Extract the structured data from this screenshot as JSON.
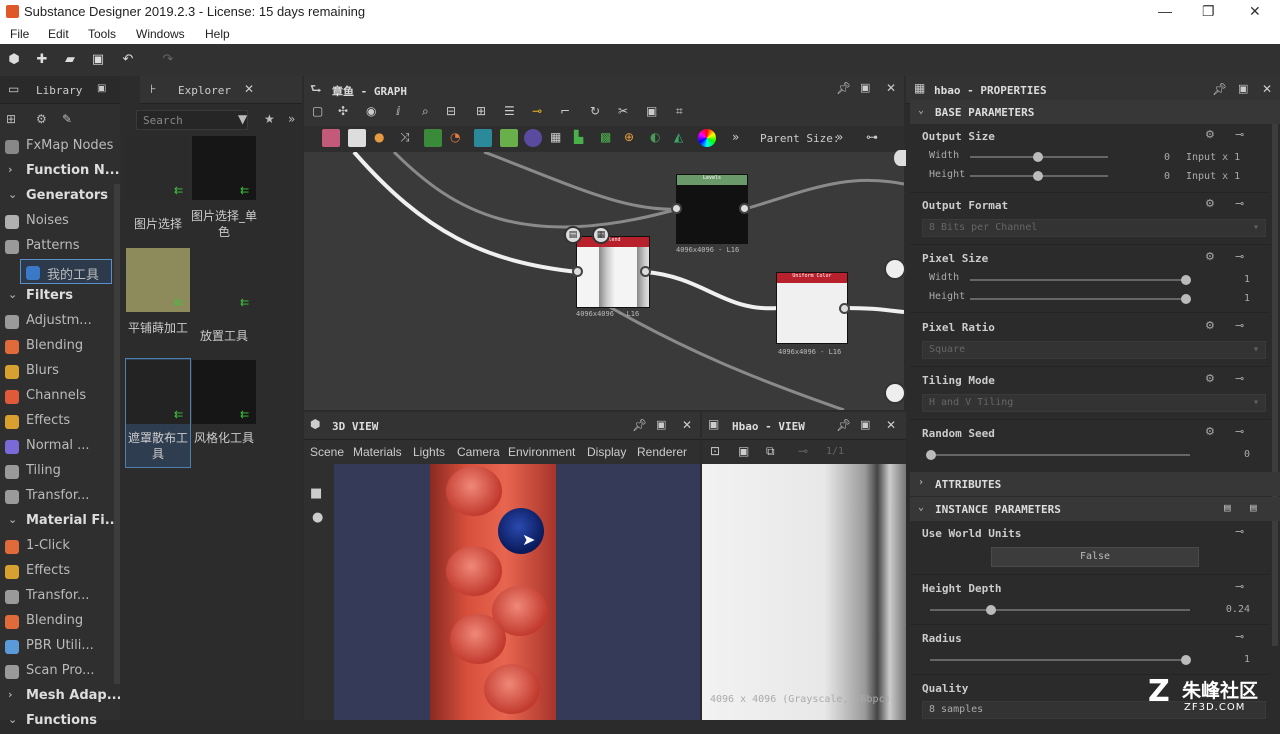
{
  "window": {
    "title": "Substance Designer 2019.2.3 - License: 15 days remaining",
    "minimize": "—",
    "restore": "❐",
    "close": "✕"
  },
  "menu": [
    "File",
    "Edit",
    "Tools",
    "Windows",
    "Help"
  ],
  "library": {
    "tab_library": "Library",
    "tab_explorer": "Explorer",
    "search_placeholder": "Search",
    "items": [
      {
        "label": "FxMap Nodes",
        "type": "item"
      },
      {
        "label": "Function N...",
        "type": "head"
      },
      {
        "label": "Generators",
        "type": "head"
      },
      {
        "label": "Noises",
        "type": "item"
      },
      {
        "label": "Patterns",
        "type": "item"
      },
      {
        "label": "我的工具",
        "type": "item"
      },
      {
        "label": "Filters",
        "type": "head"
      },
      {
        "label": "Adjustm...",
        "type": "item"
      },
      {
        "label": "Blending",
        "type": "item"
      },
      {
        "label": "Blurs",
        "type": "item"
      },
      {
        "label": "Channels",
        "type": "item"
      },
      {
        "label": "Effects",
        "type": "item"
      },
      {
        "label": "Normal ...",
        "type": "item"
      },
      {
        "label": "Tiling",
        "type": "item"
      },
      {
        "label": "Transfor...",
        "type": "item"
      },
      {
        "label": "Material Fi...",
        "type": "head"
      },
      {
        "label": "1-Click",
        "type": "item"
      },
      {
        "label": "Effects",
        "type": "item"
      },
      {
        "label": "Transfor...",
        "type": "item"
      },
      {
        "label": "Blending",
        "type": "item"
      },
      {
        "label": "PBR Utili...",
        "type": "item"
      },
      {
        "label": "Scan Pro...",
        "type": "item"
      },
      {
        "label": "Mesh Adap...",
        "type": "head"
      },
      {
        "label": "Functions",
        "type": "head"
      }
    ],
    "thumbs": [
      {
        "caption": "图片选择"
      },
      {
        "caption": "图片选择_单色"
      },
      {
        "caption": "平铺蒔加工"
      },
      {
        "caption": "放置工具"
      },
      {
        "caption": "遮罩散布工具"
      },
      {
        "caption": "风格化工具"
      }
    ]
  },
  "graph": {
    "title": "章鱼 - GRAPH",
    "parent_size": "Parent Size:",
    "nodes": [
      {
        "header": "Levels",
        "size": "4096x4096 - L16"
      },
      {
        "header": "Blend",
        "size": "4096x4096 - L16"
      },
      {
        "header": "Uniform Color",
        "size": "4096x4096 - L16"
      }
    ]
  },
  "view3d": {
    "title": "3D VIEW",
    "menu": [
      "Scene",
      "Materials",
      "Lights",
      "Camera",
      "Environment",
      "Display",
      "Renderer"
    ]
  },
  "view2d": {
    "title": "Hbao - VIEW",
    "status": "4096 x 4096 (Grayscale, 16bpc)",
    "zoom_label": "1/1"
  },
  "properties": {
    "title": "hbao - PROPERTIES",
    "base_parameters": "BASE PARAMETERS",
    "output_size": "Output Size",
    "width_label": "Width",
    "height_label": "Height",
    "output_width_value": "0",
    "output_height_value": "0",
    "output_width_mode": "Input x 1",
    "output_height_mode": "Input x 1",
    "output_format": "Output Format",
    "output_format_value": "8 Bits per Channel",
    "pixel_size": "Pixel Size",
    "pixel_width_value": "1",
    "pixel_height_value": "1",
    "pixel_ratio": "Pixel Ratio",
    "pixel_ratio_value": "Square",
    "tiling_mode": "Tiling Mode",
    "tiling_mode_value": "H and V Tiling",
    "random_seed": "Random Seed",
    "random_seed_value": "0",
    "attributes": "ATTRIBUTES",
    "instance_parameters": "INSTANCE PARAMETERS",
    "use_world_units": "Use World Units",
    "use_world_units_value": "False",
    "height_depth": "Height Depth",
    "height_depth_value": "0.24",
    "radius": "Radius",
    "radius_value": "1",
    "quality": "Quality",
    "quality_value": "8 samples"
  },
  "watermark": {
    "brand": "朱峰社区",
    "site": "ZF3D.COM"
  },
  "colors": {
    "accent": "#6ab4e8",
    "green_flag": "#3ec43e",
    "node_header_red": "#b8202c",
    "node_header_green": "#6a9a6a"
  }
}
